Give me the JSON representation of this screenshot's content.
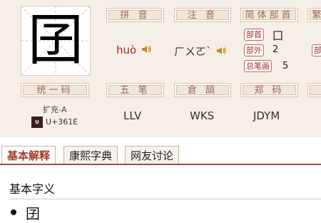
{
  "character": "囝",
  "pinyin": {
    "header": "拼 音",
    "value": "huò"
  },
  "zhuyin": {
    "header": "注 音",
    "value": "ㄏㄨㄛˋ"
  },
  "radical": {
    "header": "简体部首",
    "radical_label": "部首",
    "radical_value": "囗",
    "outer_label": "部外",
    "outer_value": "2",
    "total_label": "总笔画",
    "total_value": "5"
  },
  "cut_header_right": "繁",
  "cut_badge_right": "部",
  "unicode": {
    "header": "统一码",
    "block": "扩充-A",
    "logo": "UNICODE",
    "code": "U+361E"
  },
  "wubi": {
    "header": "五 笔",
    "value": "LLV"
  },
  "cangjie": {
    "header": "倉 頡",
    "value": "WKS"
  },
  "zhengma": {
    "header": "郑 码",
    "value": "JDYM"
  },
  "tabs": [
    {
      "label": "基本解释",
      "active": true
    },
    {
      "label": "康熙字典",
      "active": false
    },
    {
      "label": "网友讨论",
      "active": false
    }
  ],
  "section": {
    "title": "基本字义",
    "first_item_char": "囝"
  },
  "colors": {
    "accent": "#a23b2b",
    "header_text": "#9a6b57",
    "panel_bg": "#f6efe7"
  }
}
